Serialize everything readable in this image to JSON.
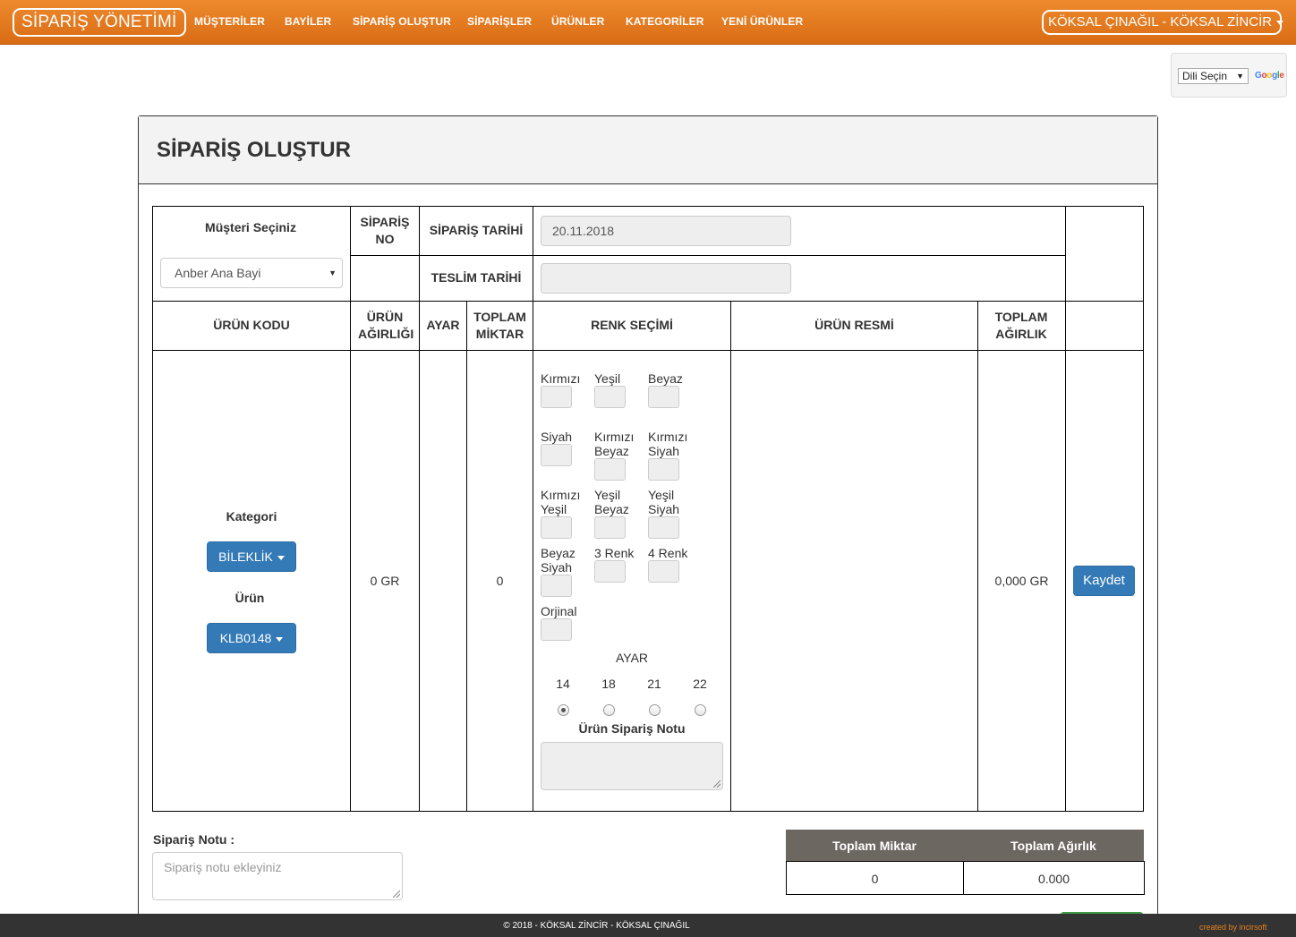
{
  "nav": {
    "brand": "SİPARİŞ YÖNETİMİ",
    "links": [
      "MÜŞTERİLER",
      "BAYİLER",
      "SİPARİŞ OLUŞTUR",
      "SİPARİŞLER",
      "ÜRÜNLER",
      "KATEGORİLER",
      "YENİ ÜRÜNLER"
    ],
    "user": "KÖKSAL ÇINAĞIL - KÖKSAL ZİNCİR"
  },
  "translate": {
    "select": "Dili Seçin",
    "logo": "Google"
  },
  "page": {
    "title": "SİPARİŞ OLUŞTUR"
  },
  "form": {
    "customer_label": "Müşteri Seçiniz",
    "customer_value": "Anber Ana Bayi",
    "order_no_label": "SİPARİŞ NO",
    "order_date_label": "SİPARİŞ TARİHİ",
    "order_date_value": "20.11.2018",
    "delivery_date_label": "TESLİM TARİHİ",
    "delivery_date_value": ""
  },
  "table": {
    "headers": {
      "product_code": "ÜRÜN KODU",
      "product_weight": "ÜRÜN AĞIRLIĞI",
      "ayar": "AYAR",
      "total_qty": "TOPLAM MİKTAR",
      "color": "RENK SEÇİMİ",
      "image": "ÜRÜN RESMİ",
      "total_weight": "TOPLAM AĞIRLIK"
    },
    "row": {
      "category_label": "Kategori",
      "category_value": "BİLEKLİK",
      "product_label": "Ürün",
      "product_value": "KLB0148",
      "weight": "0 GR",
      "qty": "0",
      "total_weight": "0,000 GR",
      "save": "Kaydet"
    },
    "colors": [
      "Kırmızı",
      "Yeşil",
      "Beyaz",
      "Siyah",
      "Kırmızı Beyaz",
      "Kırmızı Siyah",
      "Kırmızı Yeşil",
      "Yeşil Beyaz",
      "Yeşil Siyah",
      "Beyaz Siyah",
      "3 Renk",
      "4 Renk",
      "Orjinal"
    ],
    "ayar_title": "AYAR",
    "ayar_options": [
      "14",
      "18",
      "21",
      "22"
    ],
    "ayar_selected": "14",
    "product_note_label": "Ürün Sipariş Notu",
    "product_note_value": ""
  },
  "order_note": {
    "label": "Sipariş Notu :",
    "placeholder": "Sipariş notu ekleyiniz"
  },
  "totals": {
    "qty_label": "Toplam Miktar",
    "weight_label": "Toplam Ağırlık",
    "qty": "0",
    "weight": "0.000"
  },
  "footer": {
    "copy": "© 2018 - KÖKSAL ZİNCİR - KÖKSAL ÇINAĞIL",
    "credit": "created by incirsoft"
  }
}
